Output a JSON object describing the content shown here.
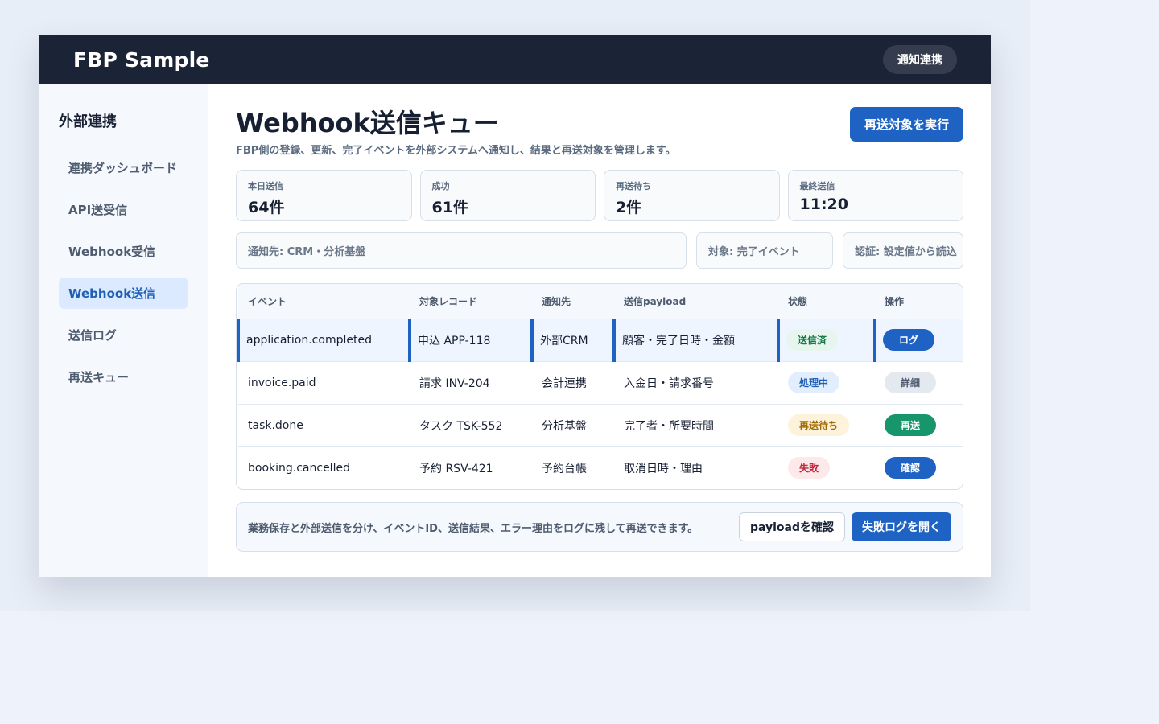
{
  "app": {
    "brand": "FBP Sample",
    "top_button": "通知連携"
  },
  "sidebar": {
    "title": "外部連携",
    "items": [
      {
        "label": "連携ダッシュボード",
        "active": false
      },
      {
        "label": "API送受信",
        "active": false
      },
      {
        "label": "Webhook受信",
        "active": false
      },
      {
        "label": "Webhook送信",
        "active": true
      },
      {
        "label": "送信ログ",
        "active": false
      },
      {
        "label": "再送キュー",
        "active": false
      }
    ]
  },
  "main": {
    "title": "Webhook送信キュー",
    "subtitle": "FBP側の登録、更新、完了イベントを外部システムへ通知し、結果と再送対象を管理します。",
    "primary_button": "再送対象を実行",
    "stats": [
      {
        "label": "本日送信",
        "value": "64件"
      },
      {
        "label": "成功",
        "value": "61件"
      },
      {
        "label": "再送待ち",
        "value": "2件"
      },
      {
        "label": "最終送信",
        "value": "11:20"
      }
    ],
    "filters": [
      "通知先: CRM・分析基盤",
      "対象: 完了イベント",
      "認証: 設定値から読込"
    ],
    "table": {
      "headers": [
        "イベント",
        "対象レコード",
        "通知先",
        "送信payload",
        "状態",
        "操作"
      ],
      "rows": [
        {
          "event": "application.completed",
          "record": "申込 APP-118",
          "target": "外部CRM",
          "payload": "顧客・完了日時・金額",
          "status": "送信済",
          "action": "ログ"
        },
        {
          "event": "invoice.paid",
          "record": "請求 INV-204",
          "target": "会計連携",
          "payload": "入金日・請求番号",
          "status": "処理中",
          "action": "詳細"
        },
        {
          "event": "task.done",
          "record": "タスク TSK-552",
          "target": "分析基盤",
          "payload": "完了者・所要時間",
          "status": "再送待ち",
          "action": "再送"
        },
        {
          "event": "booking.cancelled",
          "record": "予約 RSV-421",
          "target": "予約台帳",
          "payload": "取消日時・理由",
          "status": "失敗",
          "action": "確認"
        }
      ]
    },
    "footer": {
      "note": "業務保存と外部送信を分け、イベントID、送信結果、エラー理由をログに残して再送できます。",
      "payload_button": "payloadを確認",
      "failure_log_button": "失敗ログを開く"
    }
  }
}
